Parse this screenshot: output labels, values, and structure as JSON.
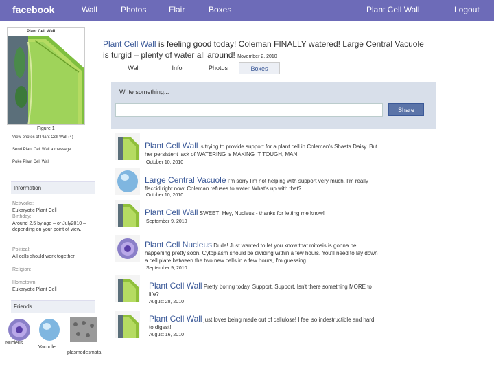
{
  "nav": {
    "logo": "facebook",
    "wall": "Wall",
    "photos": "Photos",
    "flair": "Flair",
    "boxes": "Boxes",
    "profile_name": "Plant Cell Wall",
    "logout": "Logout"
  },
  "profile": {
    "image_caption": "Plant Cell Wall",
    "figure_caption": "Figure 1",
    "links": {
      "view_photos": "View photos of Plant Cell Wall (4)",
      "send_message": "Send Plant Cell Wall a message",
      "poke": "Poke Plant Cell Wall"
    },
    "information_heading": "Information",
    "networks_label": "Networks:",
    "networks_value": "Eukaryotic Plant Cell",
    "birthday_label": "Birthday:",
    "birthday_value": "Around 2.5 by age – or July2010 – depending on your point of view..",
    "political_label": "Political:",
    "political_value": "All cells should work together",
    "religion_label": "Religion:",
    "hometown_label": "Hometown:",
    "hometown_value": "Eukaryotic Plant Cell",
    "friends_heading": "Friends",
    "friends": [
      "Nucleus",
      "Vacuole",
      "plasmodesmata"
    ]
  },
  "status": {
    "name": "Plant Cell Wall",
    "text": " is feeling good today! Coleman FINALLY watered! Large Central Vacuole is turgid – plenty of water all around! ",
    "date": "November 2, 2010"
  },
  "tabs": [
    "Wall",
    "Info",
    "Photos",
    "Boxes"
  ],
  "publisher": {
    "prompt": "Write something...",
    "share": "Share"
  },
  "feed": [
    {
      "poster": "Plant Cell Wall",
      "text": " is trying to provide support for a plant cell in Coleman's Shasta Daisy. But her persistent lack of WATERING is MAKING IT TOUGH, MAN!",
      "date": "October 10, 2010",
      "icon": "plant-cell-wall-icon"
    },
    {
      "poster": "Large Central Vacuole",
      "text": " I'm sorry I'm not helping with support very much. I'm really flaccid right now. Coleman refuses to water. What's up with that?",
      "date": "October 10, 2010",
      "icon": "vacuole-icon"
    },
    {
      "poster": "Plant Cell Wall",
      "text": " SWEET! Hey, Nucleus - thanks for letting me know!",
      "date": "September 9, 2010",
      "icon": "plant-cell-wall-icon"
    },
    {
      "poster": "Plant Cell Nucleus",
      "text": " Dude! Just wanted to let you know that mitosis is gonna be happening pretty soon. Cytoplasm should be dividing within a few hours. You'll need to lay down a cell plate between the two new cells in a few hours, I'm guessing.",
      "date": "September 9, 2010",
      "icon": "nucleus-icon"
    },
    {
      "poster": "Plant Cell Wall",
      "text": " Pretty boring today. Support, Support. Isn't there something MORE to life?",
      "date": "August 28, 2010",
      "icon": "plant-cell-wall-icon"
    },
    {
      "poster": "Plant Cell Wall",
      "text": " just loves being made out of cellulose! I feel so indestructible and hard to digest!",
      "date": "August 16, 2010",
      "icon": "plant-cell-wall-icon"
    }
  ],
  "colors": {
    "topbar": "#6d6bb8",
    "link": "#3b5998",
    "panel": "#d8dfea",
    "cell_wall_green": "#8fbf3a"
  }
}
